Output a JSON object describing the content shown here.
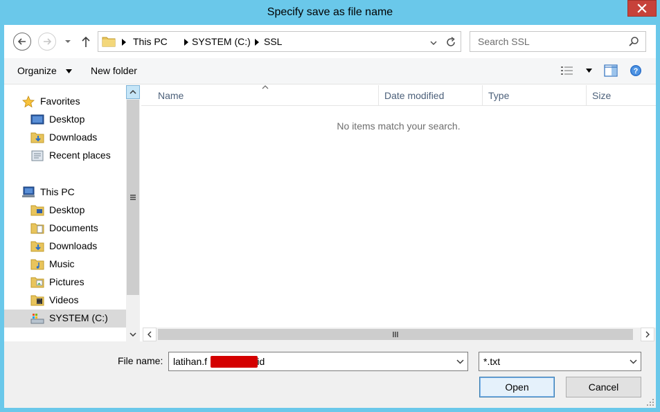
{
  "window": {
    "title": "Specify save as file name",
    "accent": "#6ac8ea",
    "close_color": "#c7423a"
  },
  "address": {
    "breadcrumbs": [
      "This PC",
      "SYSTEM (C:)",
      "SSL"
    ]
  },
  "search": {
    "placeholder": "Search SSL"
  },
  "toolbar": {
    "organize": "Organize",
    "new_folder": "New folder"
  },
  "nav": {
    "favorites_header": "Favorites",
    "favorites": [
      "Desktop",
      "Downloads",
      "Recent places"
    ],
    "thispc_header": "This PC",
    "thispc": [
      "Desktop",
      "Documents",
      "Downloads",
      "Music",
      "Pictures",
      "Videos",
      "SYSTEM (C:)"
    ],
    "selected": "SYSTEM (C:)"
  },
  "filelist": {
    "columns": [
      "Name",
      "Date modified",
      "Type",
      "Size"
    ],
    "empty_message": "No items match your search."
  },
  "form": {
    "file_name_label": "File name:",
    "file_name_value": "latihan.f          .web.id",
    "file_type_value": "*.txt"
  },
  "buttons": {
    "open": "Open",
    "cancel": "Cancel"
  },
  "icons": {
    "back": "back-arrow-icon",
    "forward": "forward-arrow-icon",
    "up": "up-arrow-icon",
    "refresh": "refresh-icon",
    "search": "search-icon",
    "help": "help-icon"
  }
}
